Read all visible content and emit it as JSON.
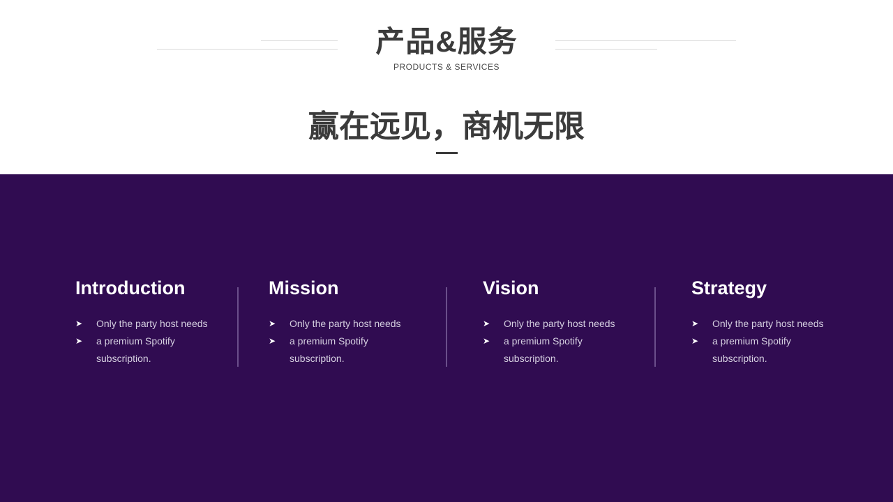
{
  "header": {
    "title": "产品&服务",
    "subtitle": "PRODUCTS & SERVICES",
    "tagline": "赢在远见，商机无限"
  },
  "columns": [
    {
      "title": "Introduction",
      "bullets": [
        "Only the party host needs",
        "a premium Spotify",
        "subscription."
      ]
    },
    {
      "title": "Mission",
      "bullets": [
        "Only the party host needs",
        "a premium Spotify",
        "subscription."
      ]
    },
    {
      "title": "Vision",
      "bullets": [
        "Only the party host needs",
        "a premium Spotify",
        "subscription."
      ]
    },
    {
      "title": "Strategy",
      "bullets": [
        "Only the party host needs",
        "a premium Spotify",
        "subscription."
      ]
    }
  ],
  "bullet_icon": "arrowhead-icon",
  "colors": {
    "accent_bg": "#300c51",
    "heading_text": "#3b3b3b",
    "body_text": "#d5cfe0",
    "divider": "#6b4f8b"
  }
}
